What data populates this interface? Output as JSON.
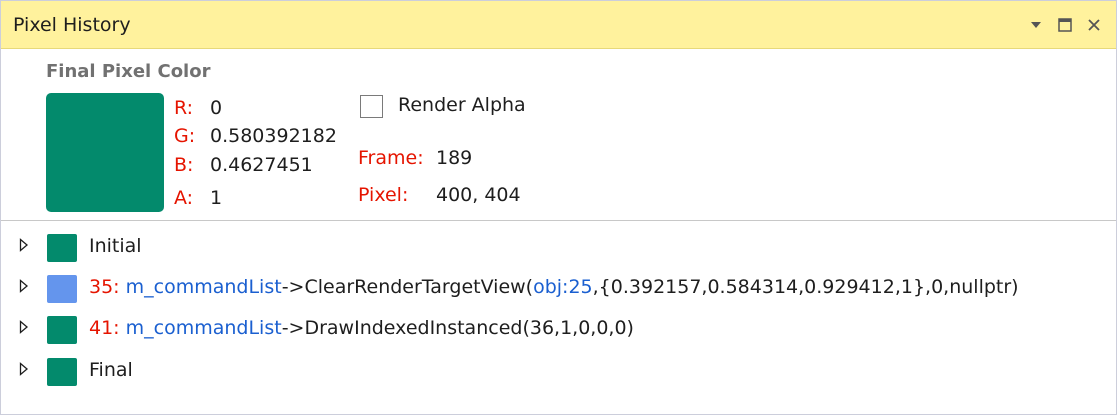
{
  "window": {
    "title": "Pixel History",
    "buttons": {
      "dropdown": "▼",
      "maximize": "☐",
      "close": "✕"
    }
  },
  "final_pixel": {
    "section_label": "Final Pixel Color",
    "swatch_color": "#038a6c",
    "channels": [
      {
        "key": "R:",
        "value": "0"
      },
      {
        "key": "G:",
        "value": "0.580392182"
      },
      {
        "key": "B:",
        "value": "0.4627451"
      },
      {
        "key": "A:",
        "value": "1"
      }
    ],
    "render_alpha": {
      "label": "Render Alpha",
      "checked": false
    },
    "frame": {
      "key": "Frame:",
      "value": "189"
    },
    "pixel": {
      "key": "Pixel:",
      "value": "400, 404"
    }
  },
  "events": [
    {
      "swatch_color": "#038a6c",
      "number": "",
      "object": "",
      "call_prefix": "",
      "call_obj": "",
      "call_suffix": "",
      "label": "Initial"
    },
    {
      "swatch_color": "#6495ed",
      "number": "35:",
      "object": "m_commandList",
      "arrow": "->",
      "call_prefix": "ClearRenderTargetView(",
      "call_obj": "obj:25",
      "call_suffix": ",{0.392157,0.584314,0.929412,1},0,nullptr)",
      "label": ""
    },
    {
      "swatch_color": "#038a6c",
      "number": "41:",
      "object": "m_commandList",
      "arrow": "->",
      "call_prefix": "DrawIndexedInstanced(36,1,0,0,0)",
      "call_obj": "",
      "call_suffix": "",
      "label": ""
    },
    {
      "swatch_color": "#038a6c",
      "number": "",
      "object": "",
      "call_prefix": "",
      "call_obj": "",
      "call_suffix": "",
      "label": "Final"
    }
  ]
}
